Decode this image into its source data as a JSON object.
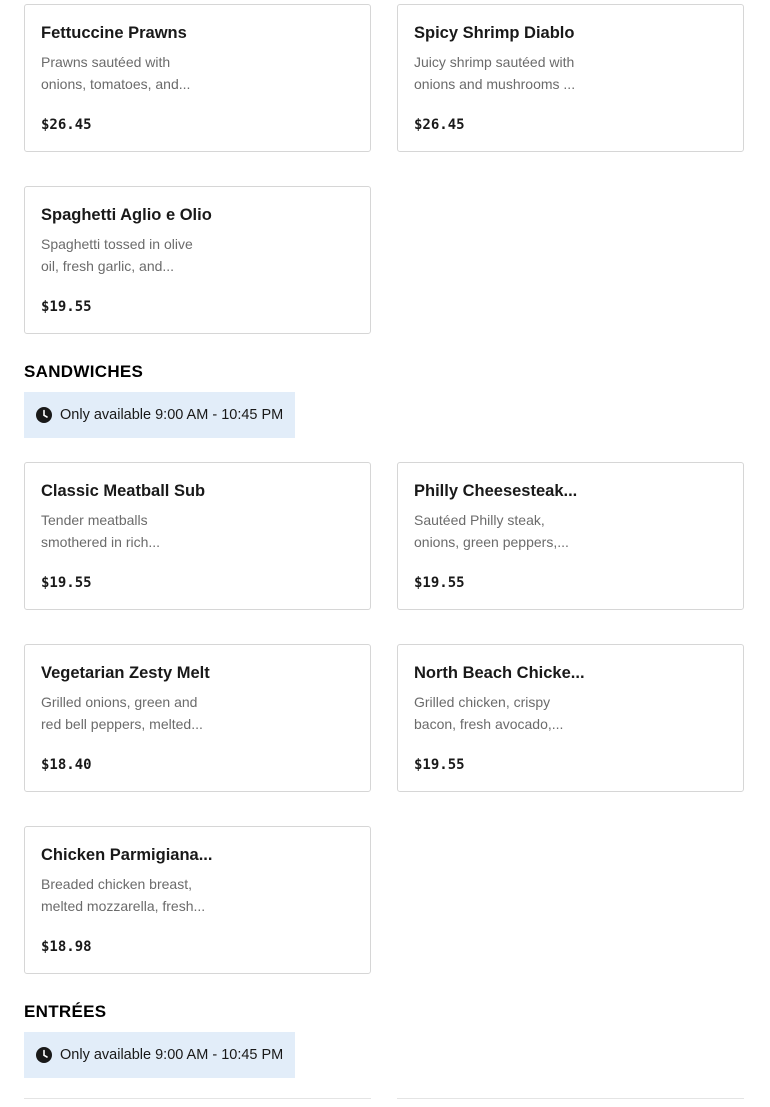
{
  "sections": [
    {
      "title": "",
      "items": [
        {
          "name": "Fettuccine Prawns",
          "desc1": "Prawns sautéed with",
          "desc2": "onions, tomatoes, and...",
          "price": "$26.45"
        },
        {
          "name": "Spicy Shrimp Diablo",
          "desc1": "Juicy shrimp sautéed with",
          "desc2": "onions and mushrooms ...",
          "price": "$26.45"
        },
        {
          "name": "Spaghetti Aglio e Olio",
          "desc1": "Spaghetti tossed in olive",
          "desc2": "oil, fresh garlic, and...",
          "price": "$19.55"
        }
      ]
    },
    {
      "title": "SANDWICHES",
      "availability": "Only available 9:00 AM - 10:45 PM",
      "items": [
        {
          "name": "Classic Meatball Sub",
          "desc1": "Tender meatballs",
          "desc2": "smothered in rich...",
          "price": "$19.55"
        },
        {
          "name": "Philly Cheesesteak...",
          "desc1": "Sautéed Philly steak,",
          "desc2": "onions, green peppers,...",
          "price": "$19.55"
        },
        {
          "name": "Vegetarian Zesty Melt",
          "desc1": "Grilled onions, green and",
          "desc2": "red bell peppers, melted...",
          "price": "$18.40"
        },
        {
          "name": "North Beach Chicke...",
          "desc1": "Grilled chicken, crispy",
          "desc2": "bacon, fresh avocado,...",
          "price": "$19.55"
        },
        {
          "name": "Chicken Parmigiana...",
          "desc1": "Breaded chicken breast,",
          "desc2": "melted mozzarella, fresh...",
          "price": "$18.98"
        }
      ]
    },
    {
      "title": "ENTRÉES",
      "availability": "Only available 9:00 AM - 10:45 PM",
      "items": []
    }
  ],
  "icons": {
    "availability": "clock-icon"
  },
  "colors": {
    "availability_bg": "#e2edf9",
    "card_border": "#d6d6d6",
    "desc_text": "#6b6b6b"
  }
}
